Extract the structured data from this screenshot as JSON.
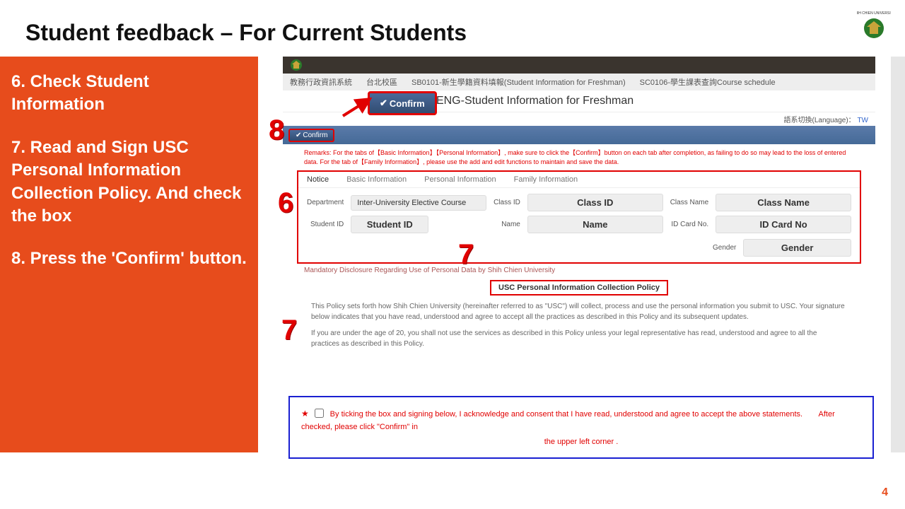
{
  "slide_title": "Student feedback – For Current Students",
  "sidebar": {
    "step6": "6. Check Student Information",
    "step7": "7. Read and Sign USC Personal Information Collection  Policy. And check the box",
    "step8": "8. Press the 'Confirm' button."
  },
  "breadcrumb": {
    "b1": "教務行政資訊系統",
    "b2": "台北校區",
    "b3": "SB0101-新生學籍資料填報(Student Information for Freshman)",
    "b4": "SC0106-學生課表查詢Course schedule"
  },
  "confirm_btn": "Confirm",
  "page_title": "SB0101ENG-Student Information for Freshman",
  "lang_label": "語系切換(Language)：",
  "lang_value": "TW",
  "remarks": "Remarks: For the tabs of【Basic Information】【Personal Information】, make sure to click the【Confirm】button on each tab after completion, as failing to do so may lead to the loss of entered data. For the tab of【Family Information】, please use the add and edit functions to maintain and save the data.",
  "tabs": {
    "t1": "Notice",
    "t2": "Basic Information",
    "t3": "Personal Information",
    "t4": "Family Information"
  },
  "fields": {
    "dept_lbl": "Department",
    "dept_val": "Inter-University Elective Course",
    "class_id_lbl": "Class ID",
    "class_id_val": "Class  ID",
    "class_name_lbl": "Class Name",
    "class_name_val": "Class Name",
    "student_id_lbl": "Student ID",
    "student_id_val": "Student ID",
    "name_lbl": "Name",
    "name_val": "Name",
    "id_card_lbl": "ID Card No.",
    "id_card_val": "ID Card No",
    "gender_lbl": "Gender",
    "gender_val": "Gender"
  },
  "disclosure_title": "Mandatory Disclosure Regarding Use of Personal Data by Shih Chien University",
  "policy_title": "USC Personal Information Collection Policy",
  "policy_p1": "This Policy sets forth how Shih Chien University (hereinafter referred to as \"USC\") will collect, process and use the personal information you submit to USC. Your signature below indicates that you have read, understood and agree to accept all the practices as described in this Policy and its subsequent updates.",
  "policy_p2": "If you are under the age of 20, you shall not use the services as described in this Policy unless your legal representative has read, understood and agree to all the practices as described in this Policy.",
  "consent": {
    "text": "By ticking the box and signing below, I acknowledge and consent that I have read, understood and agree to accept the above statements.",
    "hint1": "After checked, please click \"Confirm\" in",
    "hint2": "the upper left corner ."
  },
  "annotations": {
    "n6": "6",
    "n7": "7",
    "n8": "8"
  },
  "page_number": "4"
}
